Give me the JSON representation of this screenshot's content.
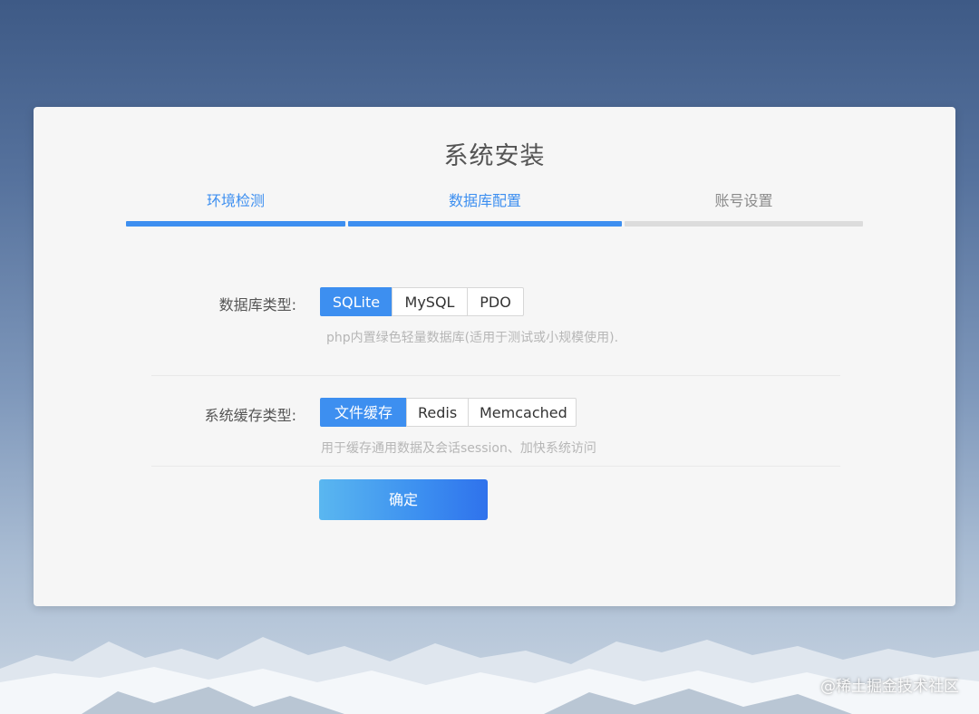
{
  "page": {
    "title": "系统安装",
    "watermark": "@稀土掘金技术社区"
  },
  "steps": [
    {
      "label": "环境检测",
      "state": "done"
    },
    {
      "label": "数据库配置",
      "state": "done"
    },
    {
      "label": "账号设置",
      "state": "todo"
    }
  ],
  "database": {
    "label": "数据库类型:",
    "options": [
      "SQLite",
      "MySQL",
      "PDO"
    ],
    "selected": "SQLite",
    "hint": "php内置绿色轻量数据库(适用于测试或小规模使用)."
  },
  "cache": {
    "label": "系统缓存类型:",
    "options": [
      "文件缓存",
      "Redis",
      "Memcached"
    ],
    "selected": "文件缓存",
    "hint": "用于缓存通用数据及会话session、加快系统访问"
  },
  "actions": {
    "confirm_label": "确定"
  },
  "colors": {
    "accent": "#3d8ff0",
    "step_inactive": "#dcdcdc",
    "card_bg": "#f6f6f6"
  }
}
